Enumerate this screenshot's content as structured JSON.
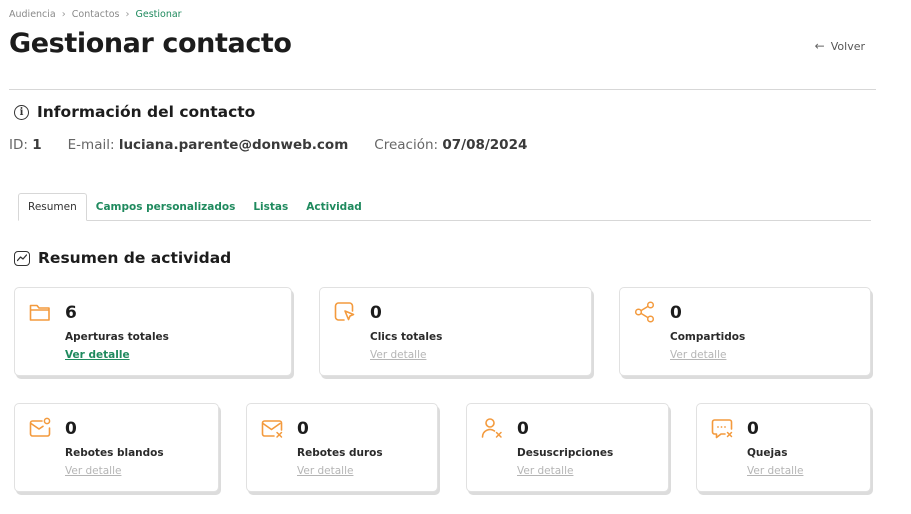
{
  "breadcrumb": {
    "items": [
      "Audiencia",
      "Contactos"
    ],
    "current": "Gestionar"
  },
  "page": {
    "title": "Gestionar contacto",
    "back_label": "Volver"
  },
  "contact_info": {
    "heading": "Información del contacto",
    "id_label": "ID:",
    "id_value": "1",
    "email_label": "E-mail:",
    "email_value": "luciana.parente@donweb.com",
    "created_label": "Creación:",
    "created_value": "07/08/2024"
  },
  "tabs": [
    {
      "label": "Resumen",
      "active": true
    },
    {
      "label": "Campos personalizados",
      "active": false
    },
    {
      "label": "Listas",
      "active": false
    },
    {
      "label": "Actividad",
      "active": false
    }
  ],
  "activity": {
    "heading": "Resumen de actividad",
    "cards": [
      {
        "icon": "folder-icon",
        "value": "6",
        "label": "Aperturas totales",
        "link": "Ver detalle",
        "link_active": true
      },
      {
        "icon": "click-icon",
        "value": "0",
        "label": "Clics totales",
        "link": "Ver detalle",
        "link_active": false
      },
      {
        "icon": "share-icon",
        "value": "0",
        "label": "Compartidos",
        "link": "Ver detalle",
        "link_active": false
      },
      {
        "icon": "soft-bounce-icon",
        "value": "0",
        "label": "Rebotes blandos",
        "link": "Ver detalle",
        "link_active": false
      },
      {
        "icon": "hard-bounce-icon",
        "value": "0",
        "label": "Rebotes duros",
        "link": "Ver detalle",
        "link_active": false
      },
      {
        "icon": "unsubscribe-icon",
        "value": "0",
        "label": "Desuscripciones",
        "link": "Ver detalle",
        "link_active": false
      },
      {
        "icon": "complaint-icon",
        "value": "0",
        "label": "Quejas",
        "link": "Ver detalle",
        "link_active": false
      }
    ]
  },
  "colors": {
    "accent_green": "#1f8a5e",
    "icon_orange": "#f39a3d",
    "muted_link": "#b5b5b5"
  }
}
